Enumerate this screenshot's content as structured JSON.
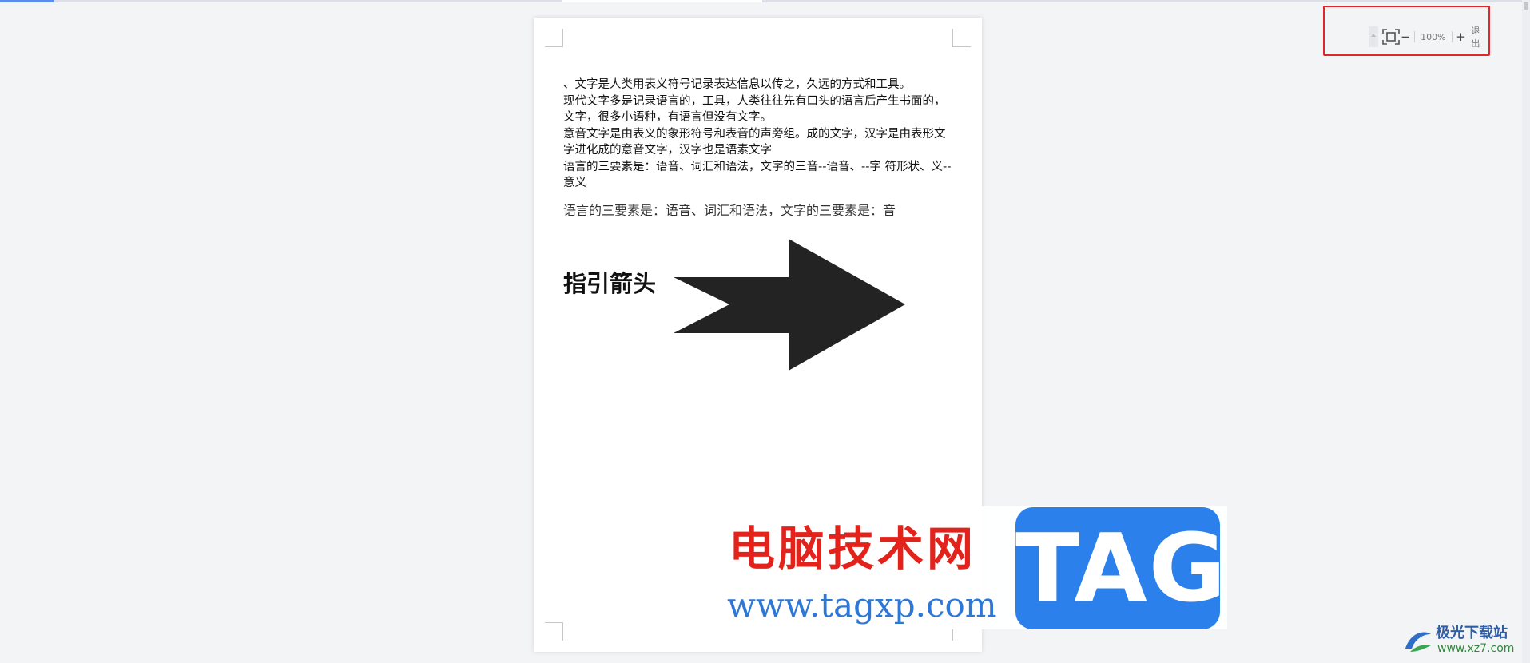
{
  "document": {
    "paragraphs": [
      "、文字是人类用表义符号记录表达信息以传之，久远的方式和工具。",
      "现代文字多是记录语言的，工具，人类往往先有口头的语言后产生书面的，文字，很多小语种，有语言但没有文字。",
      "意音文字是由表义的象形符号和表音的声旁组。成的文字，汉字是由表形文字进化成的意音文字，汉字也是语素文字",
      "语言的三要素是：语音、词汇和语法，文字的三音--语音、--字  符形状、义--意义"
    ],
    "serif_line": "语言的三要素是：语音、词汇和语法，文字的三要素是：音",
    "arrow_label": "指引箭头",
    "arrow_color": "#232323"
  },
  "zoom_toolbar": {
    "zoom_out": "−",
    "zoom_level": "100%",
    "zoom_in": "+",
    "exit_label": "退出",
    "highlight_color": "#e0262b"
  },
  "watermark": {
    "site_name": "电脑技术网",
    "url": "www.tagxp.com",
    "tag": "TAG",
    "corner_name": "极光下载站",
    "corner_url": "www.xz7.com"
  }
}
